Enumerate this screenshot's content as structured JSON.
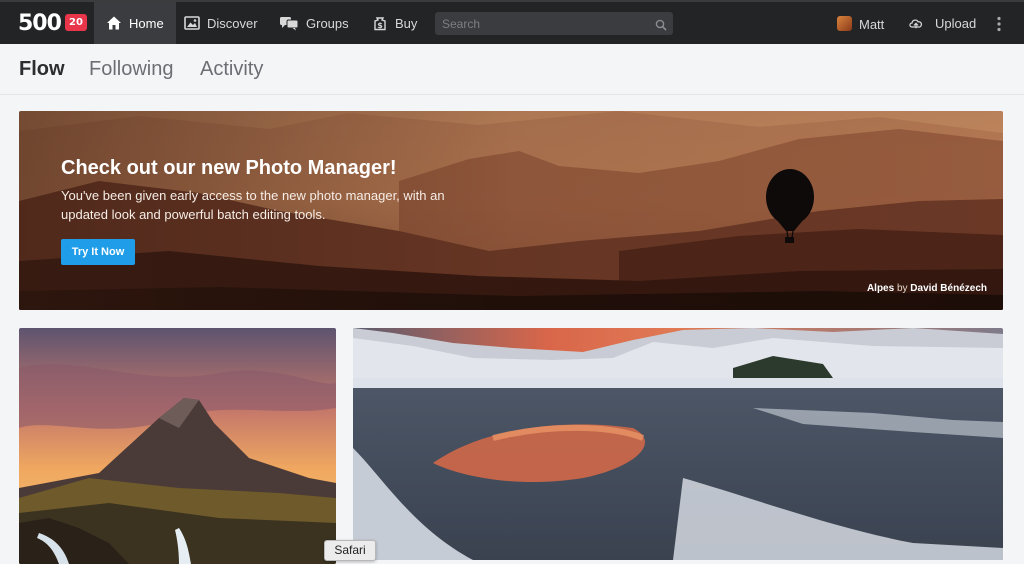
{
  "brand": {
    "logo_text": "500",
    "badge": "20"
  },
  "nav": {
    "items": [
      {
        "label": "Home",
        "icon": "home-icon"
      },
      {
        "label": "Discover",
        "icon": "image-icon"
      },
      {
        "label": "Groups",
        "icon": "chat-icon"
      },
      {
        "label": "Buy",
        "icon": "dollar-bag-icon"
      }
    ],
    "search_placeholder": "Search",
    "user": "Matt",
    "upload_label": "Upload"
  },
  "tabs": [
    "Flow",
    "Following",
    "Activity"
  ],
  "hero": {
    "title": "Check out our new Photo Manager!",
    "text": "You've been given early access to the new photo manager, with an updated look and powerful batch editing tools.",
    "button": "Try It Now",
    "credit_title": "Alpes",
    "credit_by": "by",
    "credit_author": "David Bénézech"
  },
  "tooltip": "Safari",
  "colors": {
    "accent": "#1f9de8",
    "badge": "#e8354a",
    "topbar": "#222426"
  }
}
